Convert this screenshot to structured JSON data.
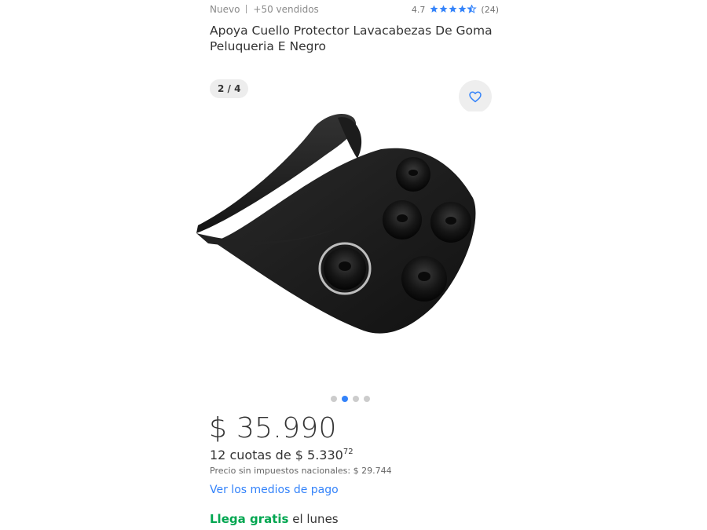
{
  "meta": {
    "condition": "Nuevo",
    "sold": "+50 vendidos",
    "rating": "4.7",
    "rating_stars": 4.7,
    "reviews": "(24)"
  },
  "product": {
    "title": "Apoya Cuello Protector Lavacabezas De Goma Peluqueria E Negro"
  },
  "gallery": {
    "counter": "2 / 4",
    "current_index": 2,
    "total_images": 4,
    "favorite_icon": "heart-icon",
    "share_icon": "share-icon",
    "image_subject": "black rubber neck rest with suction cups"
  },
  "pricing": {
    "price": "$ 35.990",
    "installments_prefix": "12 cuotas de $ 5.330",
    "installments_cents": "72",
    "taxes": "Precio sin impuestos nacionales: $ 29.744",
    "payment_link": "Ver los medios de pago"
  },
  "shipping": {
    "highlight": "Llega gratis",
    "day": " el lunes"
  },
  "colors": {
    "accent": "#3483fa",
    "shipping_green": "#00a650",
    "text": "#333333",
    "star": "#3483fa"
  }
}
